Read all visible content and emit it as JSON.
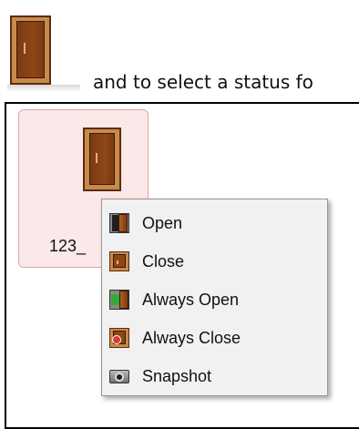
{
  "intro": {
    "text": "and to select a status fo"
  },
  "door_tile": {
    "label": "123_"
  },
  "context_menu": {
    "items": [
      {
        "label": "Open",
        "icon": "door-open-icon"
      },
      {
        "label": "Close",
        "icon": "door-close-icon"
      },
      {
        "label": "Always Open",
        "icon": "door-always-open-icon"
      },
      {
        "label": "Always Close",
        "icon": "door-always-close-icon"
      },
      {
        "label": "Snapshot",
        "icon": "camera-icon"
      }
    ]
  },
  "colors": {
    "tile_background": "#fbe8e8",
    "tile_border": "#e3a7a7",
    "menu_background": "#f1f1f1",
    "door_brown": "#8e4618"
  }
}
